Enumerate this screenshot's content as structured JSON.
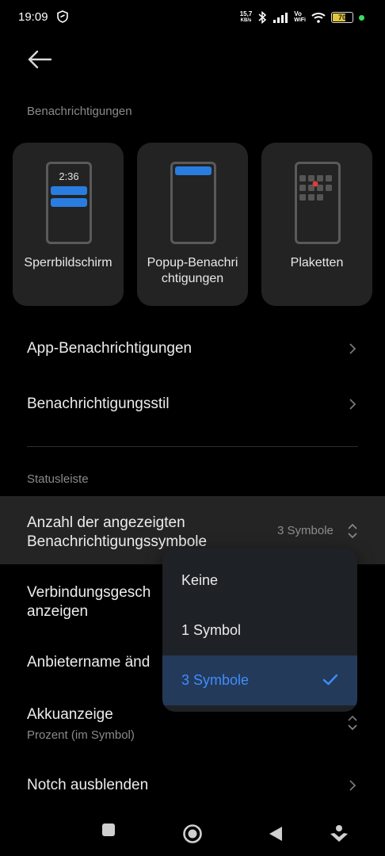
{
  "status_bar": {
    "time": "19:09",
    "net_speed_value": "15,7",
    "net_speed_unit": "KB/s",
    "vowifi_top": "Vo",
    "vowifi_bottom": "WiFi",
    "battery": "70",
    "battery_level": 0.7
  },
  "page": {
    "section_notifications": "Benachrichtigungen",
    "cards": [
      {
        "label": "Sperrbildschirm",
        "clock": "2:36"
      },
      {
        "label_line1": "Popup-Benachri",
        "label_line2": "chtigungen"
      },
      {
        "label": "Plaketten"
      }
    ],
    "rows": {
      "app_notifications": "App-Benachrichtigungen",
      "notification_style": "Benachrichtigungsstil"
    },
    "section_statusbar": "Statusleiste",
    "icons_count": {
      "title_line1": "Anzahl der angezeigten",
      "title_line2": "Benachrichtigungssymbole",
      "value": "3 Symbole"
    },
    "connection_speed": {
      "line1": "Verbindungsgesch",
      "line2": "anzeigen"
    },
    "carrier_name": "Anbietername änd",
    "battery_indicator": {
      "title": "Akkuanzeige",
      "subtitle": "Prozent (im Symbol)"
    },
    "hide_notch": "Notch ausblenden"
  },
  "popup": {
    "options": [
      "Keine",
      "1 Symbol",
      "3 Symbole"
    ],
    "selected_index": 2
  },
  "colors": {
    "accent": "#3f8cff",
    "background": "#000000",
    "card": "#232323",
    "phone_badge_blue": "#2a7de0",
    "badge_red": "#e23b3b"
  }
}
